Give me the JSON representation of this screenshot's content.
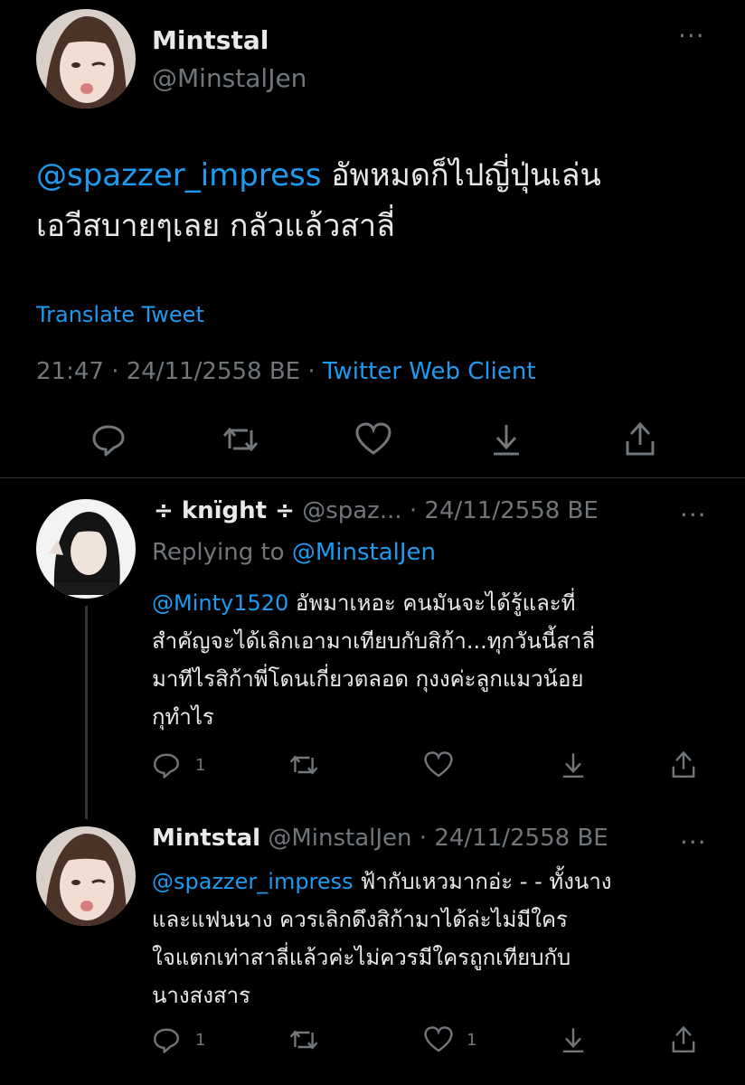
{
  "main_tweet": {
    "display_name": "Mintstal",
    "handle": "@MinstalJen",
    "mention": "@spazzer_impress",
    "text_line1": "อัพหมดก็ไปญี่ปุ่นเล่น",
    "text_line2": "เอวีสบายๆเลย กลัวแล้วสาลี่",
    "translate_label": "Translate Tweet",
    "time": "21:47 · 24/11/2558 BE ·",
    "client": "Twitter Web Client"
  },
  "reply1": {
    "display_name": "÷ knïght ÷",
    "handle_date": "@spaz... · 24/11/2558 BE",
    "replying_prefix": "Replying to",
    "replying_handle": "@MinstalJen",
    "mention": "@Minty1520",
    "line1": "อัพมาเหอะ คนมันจะได้รู้และที่",
    "line2": "สำคัญจะได้เลิกเอามาเทียบกับสิก้า...ทุกวันนี้สาลี่",
    "line3": "มาทีไรสิก้าพี่โดนเกี่ยวตลอด กุงงค่ะลูกแมวน้อย",
    "line4": "กุทำไร",
    "reply_count": "1"
  },
  "reply2": {
    "display_name": "Mintstal",
    "handle_date": "@MinstalJen · 24/11/2558 BE",
    "mention": "@spazzer_impress",
    "line1": "ฟ้ากับเหวมากอ่ะ - - ทั้งนาง",
    "line2": "และแฟนนาง ควรเลิกดึงสิก้ามาได้ล่ะไม่มีใคร",
    "line3": "ใจแตกเท่าสาลี่แล้วค่ะไม่ควรมีใครถูกเทียบกับ",
    "line4": "นางสงสาร",
    "reply_count": "1",
    "like_count": "1"
  },
  "colors": {
    "background": "#000000",
    "link": "#1d9bf0",
    "muted": "#71767b",
    "text": "#e7e9ea"
  },
  "icons": [
    "reply-icon",
    "retweet-icon",
    "like-icon",
    "download-icon",
    "share-icon",
    "more-icon"
  ]
}
